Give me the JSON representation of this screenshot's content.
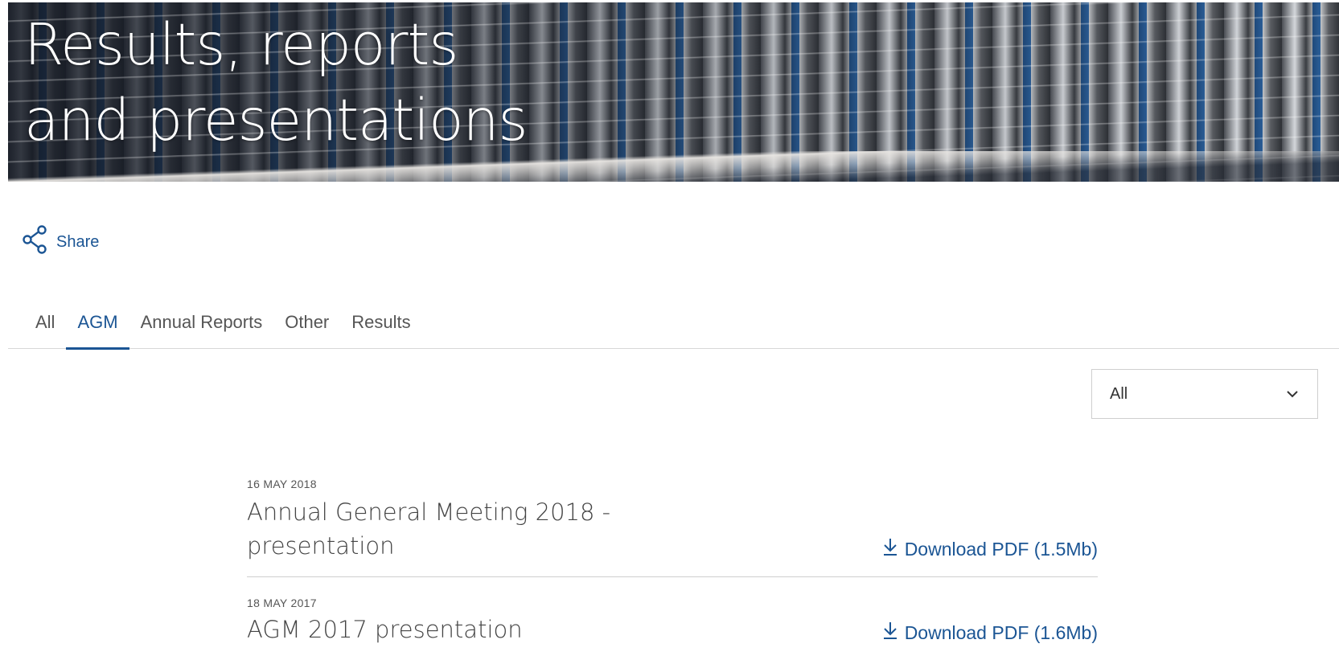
{
  "hero": {
    "title_line1": "Results, reports",
    "title_line2": "and presentations"
  },
  "share": {
    "label": "Share",
    "icon": "share-icon"
  },
  "tabs": [
    {
      "label": "All",
      "active": false
    },
    {
      "label": "AGM",
      "active": true
    },
    {
      "label": "Annual Reports",
      "active": false
    },
    {
      "label": "Other",
      "active": false
    },
    {
      "label": "Results",
      "active": false
    }
  ],
  "filter": {
    "selected": "All",
    "icon": "chevron-down-icon"
  },
  "items": [
    {
      "date": "16 MAY 2018",
      "title": "Annual General Meeting 2018 - presentation",
      "download_label": "Download PDF (1.5Mb)"
    },
    {
      "date": "18 MAY 2017",
      "title": "AGM 2017 presentation",
      "download_label": "Download PDF (1.6Mb)"
    }
  ],
  "colors": {
    "accent": "#1b5594",
    "text": "#444444",
    "border": "#cfcfcf"
  }
}
